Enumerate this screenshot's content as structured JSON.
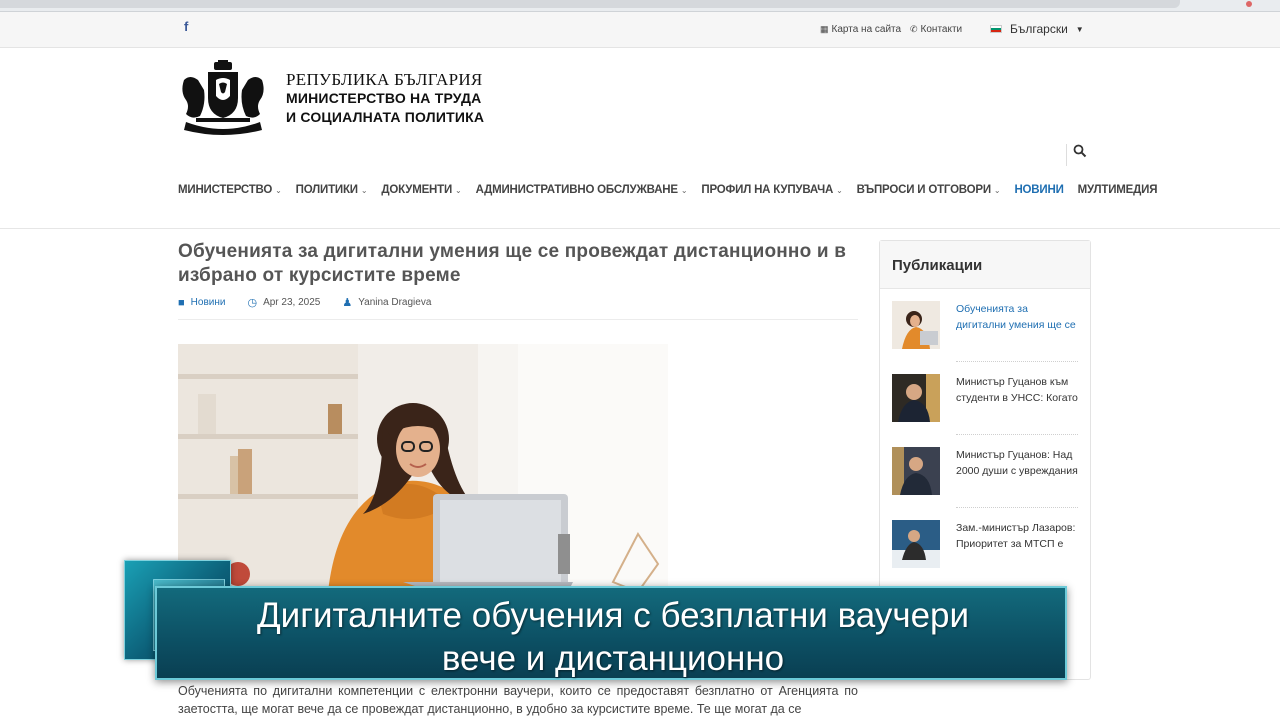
{
  "topbar": {
    "facebook": "f",
    "sitemap_label": "Карта на сайта",
    "contacts_label": "Контакти",
    "language_label": "Български"
  },
  "logo": {
    "line1": "РЕПУБЛИКА БЪЛГАРИЯ",
    "line2": "МИНИСТЕРСТВО НА ТРУДА",
    "line3": "И СОЦИАЛНАТА ПОЛИТИКА"
  },
  "nav": {
    "items": [
      {
        "label": "МИНИСТЕРСТВО",
        "dropdown": true
      },
      {
        "label": "ПОЛИТИКИ",
        "dropdown": true
      },
      {
        "label": "ДОКУМЕНТИ",
        "dropdown": true
      },
      {
        "label": "АДМИНИСТРАТИВНО ОБСЛУЖВАНЕ",
        "dropdown": true
      },
      {
        "label": "ПРОФИЛ НА КУПУВАЧА",
        "dropdown": true
      },
      {
        "label": "ВЪПРОСИ И ОТГОВОРИ",
        "dropdown": true
      },
      {
        "label": "НОВИНИ",
        "dropdown": false,
        "active": true
      },
      {
        "label": "МУЛТИМЕДИЯ",
        "dropdown": false
      }
    ]
  },
  "article": {
    "title": "Обученията за дигитални умения ще се провеждат дистанционно и в избрано от курсистите време",
    "category": "Новини",
    "date": "Apr 23, 2025",
    "author": "Yanina Dragieva",
    "body": "Обученията по дигитални компетенции с електронни ваучери, които се предоставят безплатно от Агенцията по заетостта, ще могат вече да се провеждат дистанционно, в удобно за курсистите време. Те ще могат да се"
  },
  "sidebar": {
    "title": "Публикации",
    "items": [
      {
        "text": "Обученията за дигитални умения ще се"
      },
      {
        "text": "Министър Гуцанов към студенти в УНСС: Когато"
      },
      {
        "text": "Министър Гуцанов: Над 2000 души с увреждания"
      },
      {
        "text": "Зам.-министър Лазаров: Приоритет за МТСП е"
      }
    ]
  },
  "banner": {
    "line1": "Дигиталните обучения с безплатни ваучери",
    "line2": "вече и дистанционно"
  },
  "colors": {
    "link_blue": "#1f6fb2",
    "banner_teal": "#0c4f63"
  }
}
